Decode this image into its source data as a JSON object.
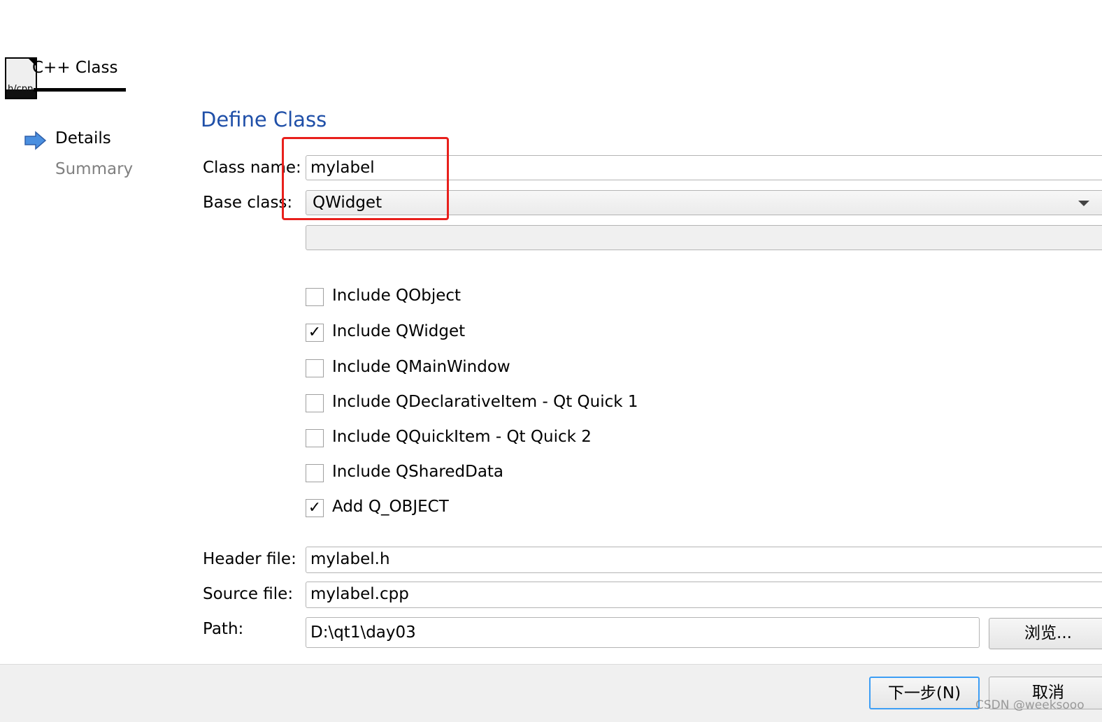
{
  "wizard": {
    "title": "C++ Class",
    "icon_text": "h/cpp",
    "steps": [
      {
        "label": "Details",
        "active": true
      },
      {
        "label": "Summary",
        "active": false
      }
    ]
  },
  "page": {
    "title": "Define Class",
    "class_name_label": "Class name:",
    "class_name_value": "mylabel",
    "base_class_label": "Base class:",
    "base_class_value": "QWidget",
    "base_class_custom_value": "",
    "checkboxes": [
      {
        "label": "Include QObject",
        "checked": false
      },
      {
        "label": "Include QWidget",
        "checked": true
      },
      {
        "label": "Include QMainWindow",
        "checked": false
      },
      {
        "label": "Include QDeclarativeItem - Qt Quick 1",
        "checked": false
      },
      {
        "label": "Include QQuickItem - Qt Quick 2",
        "checked": false
      },
      {
        "label": "Include QSharedData",
        "checked": false
      },
      {
        "label": "Add Q_OBJECT",
        "checked": true
      }
    ],
    "check_mark": "✓",
    "header_file_label": "Header file:",
    "header_file_value": "mylabel.h",
    "source_file_label": "Source file:",
    "source_file_value": "mylabel.cpp",
    "path_label": "Path:",
    "path_value": "D:\\qt1\\day03",
    "browse_label": "浏览..."
  },
  "footer": {
    "next_label": "下一步(N)",
    "cancel_label": "取消"
  },
  "watermark": "CSDN @weeksooo",
  "colors": {
    "title": "#1f4fa8",
    "highlight_box": "#e8201c",
    "focus_border": "#3d9ef5"
  }
}
